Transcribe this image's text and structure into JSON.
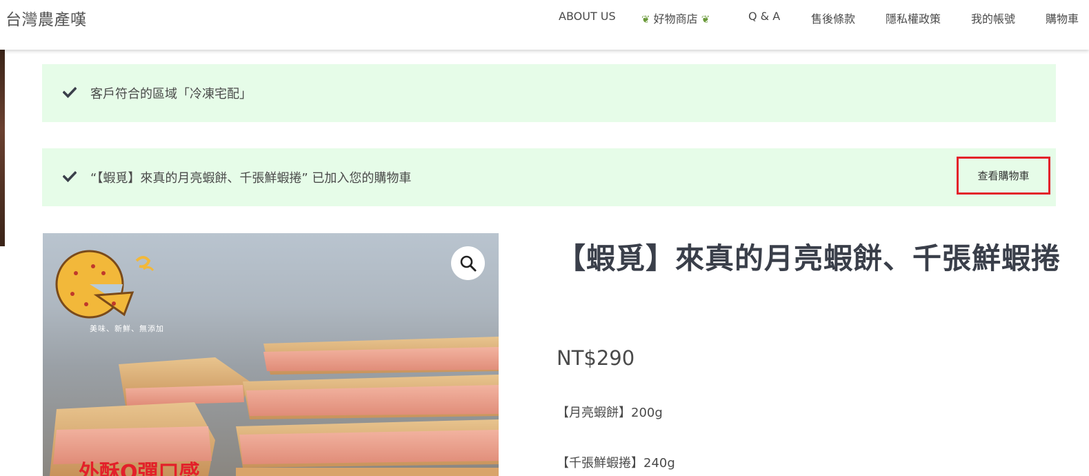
{
  "site": {
    "title": "台灣農產嘆"
  },
  "nav": {
    "items": [
      {
        "label": "ABOUT US"
      },
      {
        "label": "好物商店",
        "icon": "leaf-icon"
      },
      {
        "label": "Q & A"
      },
      {
        "label": "售後條款"
      },
      {
        "label": "隱私權政策"
      },
      {
        "label": "我的帳號"
      },
      {
        "label": "購物車"
      }
    ]
  },
  "notices": [
    {
      "text": "客戶符合的區域「冷凍宅配」",
      "icon": "check-icon"
    },
    {
      "text": "“【蝦覓】來真的月亮蝦餅、千張鮮蝦捲” 已加入您的購物車",
      "icon": "check-icon",
      "button_label": "查看購物車"
    }
  ],
  "product": {
    "image": {
      "tagline": "美味、新鮮、無添加",
      "promo": "外酥Q彈口感",
      "zoom_icon": "search-icon"
    },
    "title": "【蝦覓】來真的月亮蝦餅、千張鮮蝦捲",
    "price": "NT$290",
    "specs": [
      "【月亮蝦餅】200g",
      "【千張鮮蝦捲】240g"
    ]
  },
  "colors": {
    "notice_bg": "#e6fce8",
    "highlight_border": "#e3202a",
    "title_text": "#3a3f4a"
  }
}
